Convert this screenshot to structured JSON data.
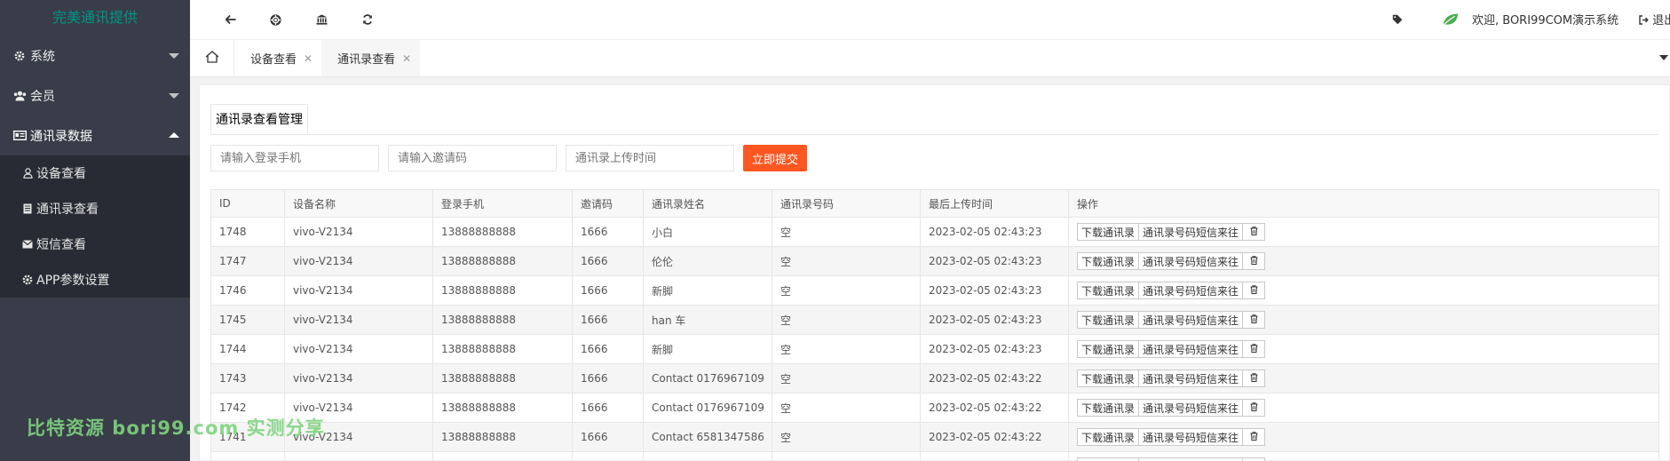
{
  "sidebar": {
    "logo": "完美通讯提供",
    "groups": [
      {
        "label": "系统",
        "icon": "gear-icon"
      },
      {
        "label": "会员",
        "icon": "users-icon"
      },
      {
        "label": "通讯录数据",
        "icon": "id-card-icon"
      }
    ],
    "subitems": [
      {
        "label": "设备查看",
        "icon": "user-icon"
      },
      {
        "label": "通讯录查看",
        "icon": "book-icon"
      },
      {
        "label": "短信查看",
        "icon": "envelope-icon"
      },
      {
        "label": "APP参数设置",
        "icon": "gear-icon"
      }
    ],
    "watermark": "比特资源 bori99.com 实测分享"
  },
  "header": {
    "icons": [
      "back-arrow-icon",
      "life-ring-icon",
      "bank-icon",
      "refresh-icon"
    ],
    "tag_icon": "tag-icon",
    "leaf_icon": "leaf-icon",
    "welcome": "欢迎, BORI99COM演示系统",
    "logout": "退出"
  },
  "tabs": [
    {
      "label": "设备查看",
      "active": false
    },
    {
      "label": "通讯录查看",
      "active": true
    }
  ],
  "panel": {
    "title": "通讯录查看管理"
  },
  "search": {
    "phone_placeholder": "请输入登录手机",
    "invite_placeholder": "请输入邀请码",
    "time_placeholder": "通讯录上传时间",
    "submit": "立即提交"
  },
  "table": {
    "columns": [
      "ID",
      "设备名称",
      "登录手机",
      "邀请码",
      "通讯录姓名",
      "通讯录号码",
      "最后上传时间",
      "操作"
    ],
    "actions": {
      "download": "下载通讯录",
      "sms": "通讯录号码短信来往"
    },
    "rows": [
      [
        "1748",
        "vivo-V2134",
        "13888888888",
        "1666",
        "小白",
        "空",
        "2023-02-05 02:43:23"
      ],
      [
        "1747",
        "vivo-V2134",
        "13888888888",
        "1666",
        "伦伦",
        "空",
        "2023-02-05 02:43:23"
      ],
      [
        "1746",
        "vivo-V2134",
        "13888888888",
        "1666",
        "新脚",
        "空",
        "2023-02-05 02:43:23"
      ],
      [
        "1745",
        "vivo-V2134",
        "13888888888",
        "1666",
        "han 车",
        "空",
        "2023-02-05 02:43:23"
      ],
      [
        "1744",
        "vivo-V2134",
        "13888888888",
        "1666",
        "新脚",
        "空",
        "2023-02-05 02:43:23"
      ],
      [
        "1743",
        "vivo-V2134",
        "13888888888",
        "1666",
        "Contact 0176967109",
        "空",
        "2023-02-05 02:43:22"
      ],
      [
        "1742",
        "vivo-V2134",
        "13888888888",
        "1666",
        "Contact 0176967109",
        "空",
        "2023-02-05 02:43:22"
      ],
      [
        "1741",
        "vivo-V2134",
        "13888888888",
        "1666",
        "Contact 6581347586",
        "空",
        "2023-02-05 02:43:22"
      ],
      [
        "",
        "",
        "",
        "",
        "",
        "",
        ""
      ]
    ]
  }
}
